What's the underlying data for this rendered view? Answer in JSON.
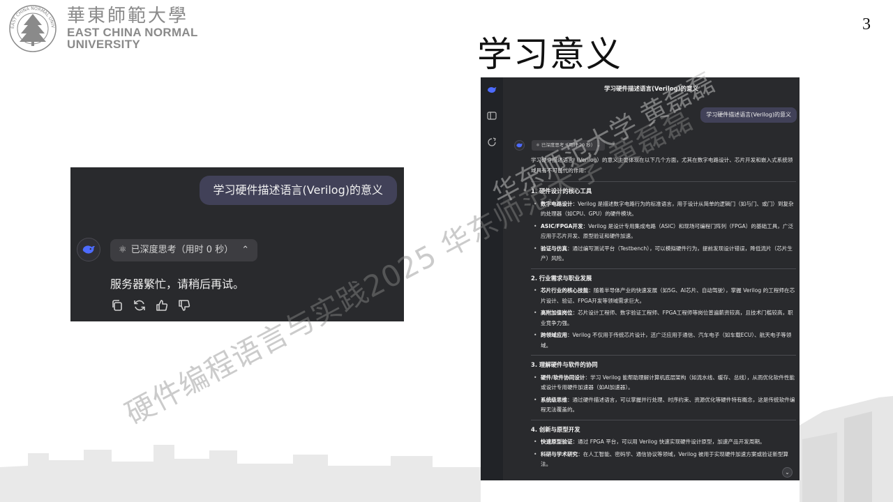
{
  "slide": {
    "page_number": "3",
    "title": "学习意义"
  },
  "logo": {
    "cn": "華東師範大學",
    "en_line1": "EAST CHINA NORMAL",
    "en_line2": "UNIVERSITY",
    "seal_text": "EAST CHINA NORMAL UNIVERSITY"
  },
  "left_screenshot": {
    "user_message": "学习硬件描述语言(Verilog)的意义",
    "thinking_label": "已深度思考（用时 0 秒）",
    "reply": "服务器繁忙，请稍后再试。",
    "actions": [
      "copy-icon",
      "regenerate-icon",
      "thumbs-up-icon",
      "thumbs-down-icon"
    ]
  },
  "right_screenshot": {
    "header": "学习硬件描述语言(Verilog)的意义",
    "user_message": "学习硬件描述语言(Verilog)的意义",
    "thinking_label": "已深度思考（用时 20 秒）",
    "intro": "学习硬件描述语言（Verilog）的意义主要体现在以下几个方面，尤其在数字电路设计、芯片开发和嵌入式系统领域具有不可替代的作用：",
    "sections": [
      {
        "title": "1. 硬件设计的核心工具",
        "items": [
          {
            "bold": "数字电路设计",
            "text": "：Verilog 是描述数字电路行为的标准语言，用于设计从简单的逻辑门（如与门、或门）到复杂的处理器（如CPU、GPU）的硬件模块。"
          },
          {
            "bold": "ASIC/FPGA开发",
            "text": "：Verilog 是设计专用集成电路（ASIC）和现场可编程门阵列（FPGA）的基础工具，广泛应用于芯片开发、原型验证和硬件加速。"
          },
          {
            "bold": "验证与仿真",
            "text": "：通过编写测试平台（Testbench），可以模拟硬件行为，提前发现设计错误，降低流片（芯片生产）风险。"
          }
        ]
      },
      {
        "title": "2. 行业需求与职业发展",
        "items": [
          {
            "bold": "芯片行业的核心技能",
            "text": "：随着半导体产业的快速发展（如5G、AI芯片、自动驾驶），掌握 Verilog 的工程师在芯片设计、验证、FPGA开发等领域需求巨大。"
          },
          {
            "bold": "高附加值岗位",
            "text": "：芯片设计工程师、数字验证工程师、FPGA工程师等岗位普遍薪资较高，且技术门槛较高，职业竞争力强。"
          },
          {
            "bold": "跨领域应用",
            "text": "：Verilog 不仅用于传统芯片设计，还广泛应用于通信、汽车电子（如车载ECU）、航天电子等领域。"
          }
        ]
      },
      {
        "title": "3. 理解硬件与软件的协同",
        "items": [
          {
            "bold": "硬件/软件协同设计",
            "text": "：学习 Verilog 能帮助理解计算机底层架构（如流水线、缓存、总线），从而优化软件性能或设计专用硬件加速器（如AI加速器）。"
          },
          {
            "bold": "系统级思维",
            "text": "：通过硬件描述语言，可以掌握并行处理、时序约束、资源优化等硬件特有概念，这是传统软件编程无法覆盖的。"
          }
        ]
      },
      {
        "title": "4. 创新与原型开发",
        "items": [
          {
            "bold": "快速原型验证",
            "text": "：通过 FPGA 平台，可以用 Verilog 快速实现硬件设计原型，加速产品开发周期。"
          },
          {
            "bold": "科研与学术研究",
            "text": "：在人工智能、密码学、通信协议等领域，Verilog 被用于实现硬件加速方案或验证新型算法。"
          }
        ]
      }
    ]
  },
  "watermark": {
    "main": "硬件编程语言与实践2025 华东师范大学 黄磊磊",
    "right": "华东师范大学 黄磊磊"
  },
  "colors": {
    "panel_bg": "#292a2d",
    "bubble_bg": "#414158",
    "pill_bg": "#3d3d41",
    "accent": "#4d6bfe",
    "logo_gray": "#8a8a8a"
  }
}
